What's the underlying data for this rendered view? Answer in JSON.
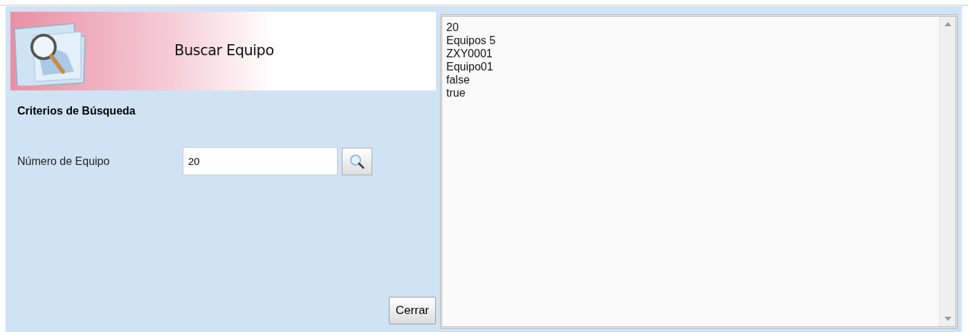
{
  "header": {
    "title": "Buscar Equipo"
  },
  "section_title": "Criterios de Búsqueda",
  "fields": [
    {
      "label": "Número de Equipo",
      "value": "20"
    }
  ],
  "close_button": "Cerrar",
  "output_lines": [
    "20",
    "Equipos 5",
    "ZXY0001",
    "Equipo01",
    "false",
    "true"
  ]
}
